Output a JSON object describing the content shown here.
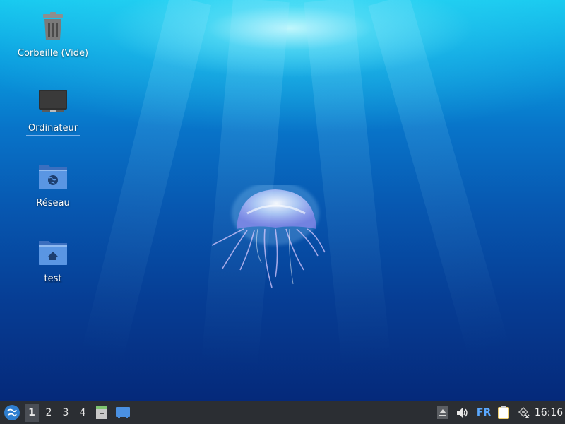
{
  "desktop": {
    "icons": [
      {
        "label": "Corbeille (Vide)",
        "icon": "trash-icon"
      },
      {
        "label": "Ordinateur",
        "icon": "computer-icon"
      },
      {
        "label": "Réseau",
        "icon": "network-folder-icon"
      },
      {
        "label": "test",
        "icon": "home-folder-icon"
      }
    ],
    "wallpaper": "jellyfish-underwater"
  },
  "panel": {
    "workspaces": [
      "1",
      "2",
      "3",
      "4"
    ],
    "active_workspace": "1",
    "keyboard_layout": "FR",
    "clock": "16:16"
  },
  "colors": {
    "panel_bg": "#2b2e33",
    "accent": "#5aa8ff",
    "folder_blue": "#4a86d9"
  }
}
